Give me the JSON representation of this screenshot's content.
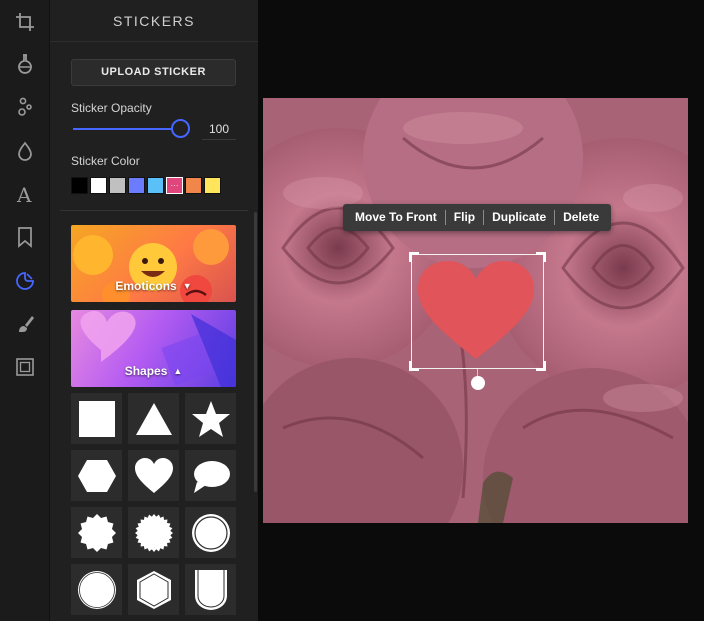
{
  "rail": {
    "tools": [
      {
        "icon": "crop-icon",
        "active": false
      },
      {
        "icon": "filter-flask-icon",
        "active": false
      },
      {
        "icon": "adjust-nodes-icon",
        "active": false
      },
      {
        "icon": "drop-icon",
        "active": false
      },
      {
        "icon": "text-icon",
        "glyph": "A",
        "active": false
      },
      {
        "icon": "bookmark-icon",
        "active": false
      },
      {
        "icon": "sticker-icon",
        "active": true
      },
      {
        "icon": "brush-icon",
        "active": false
      },
      {
        "icon": "frame-icon",
        "active": false
      }
    ],
    "active_color": "#4566ff"
  },
  "panel": {
    "title": "STICKERS",
    "upload_label": "UPLOAD STICKER",
    "opacity_label": "Sticker Opacity",
    "opacity_value": "100",
    "opacity_fraction": 1.0,
    "color_label": "Sticker Color",
    "swatches": [
      "#000000",
      "#ffffff",
      "#c0c0c0",
      "#6b7cff",
      "#5bc0f8",
      "#e0457b",
      "#f0864a",
      "#ffe55c"
    ],
    "selected_swatch": 5,
    "selected_mark": "···",
    "categories": [
      {
        "label": "Emoticons",
        "caret": "down"
      },
      {
        "label": "Shapes",
        "caret": "up"
      }
    ],
    "shapes": [
      "square",
      "triangle",
      "star",
      "hexagon",
      "heart",
      "speech-bubble",
      "badge-12",
      "badge-24",
      "circle-ring",
      "circle-outline",
      "hexagon-outline",
      "shield-outline"
    ]
  },
  "toolbar": {
    "items": [
      "Move To Front",
      "Flip",
      "Duplicate",
      "Delete"
    ]
  },
  "sticker": {
    "shape": "heart",
    "color": "#e15459"
  }
}
